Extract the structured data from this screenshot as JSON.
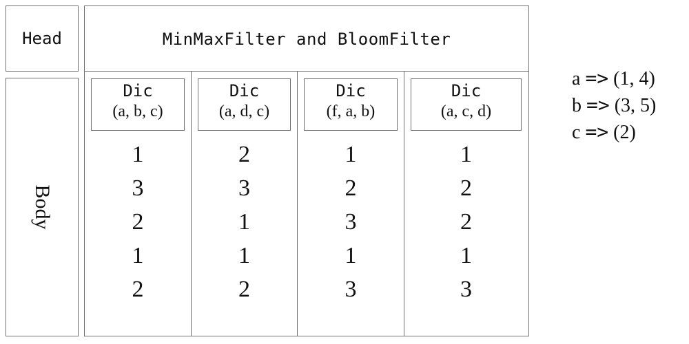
{
  "head": {
    "label": "Head"
  },
  "body": {
    "label": "Body"
  },
  "main": {
    "title": "MinMaxFilter and BloomFilter",
    "columns": [
      {
        "dic_title": "Dic",
        "dic_keys": "(a, b, c)",
        "values": [
          "1",
          "3",
          "2",
          "1",
          "2"
        ]
      },
      {
        "dic_title": "Dic",
        "dic_keys": "(a, d, c)",
        "values": [
          "2",
          "3",
          "1",
          "1",
          "2"
        ]
      },
      {
        "dic_title": "Dic",
        "dic_keys": "(f, a, b)",
        "values": [
          "1",
          "2",
          "3",
          "1",
          "3"
        ]
      },
      {
        "dic_title": "Dic",
        "dic_keys": "(a, c, d)",
        "values": [
          "1",
          "2",
          "2",
          "1",
          "3"
        ]
      }
    ]
  },
  "mapping": [
    {
      "key": "a",
      "arrow": "=>",
      "value": "(1, 4)"
    },
    {
      "key": "b",
      "arrow": "=>",
      "value": "(3, 5)"
    },
    {
      "key": "c",
      "arrow": "=>",
      "value": "(2)"
    }
  ]
}
